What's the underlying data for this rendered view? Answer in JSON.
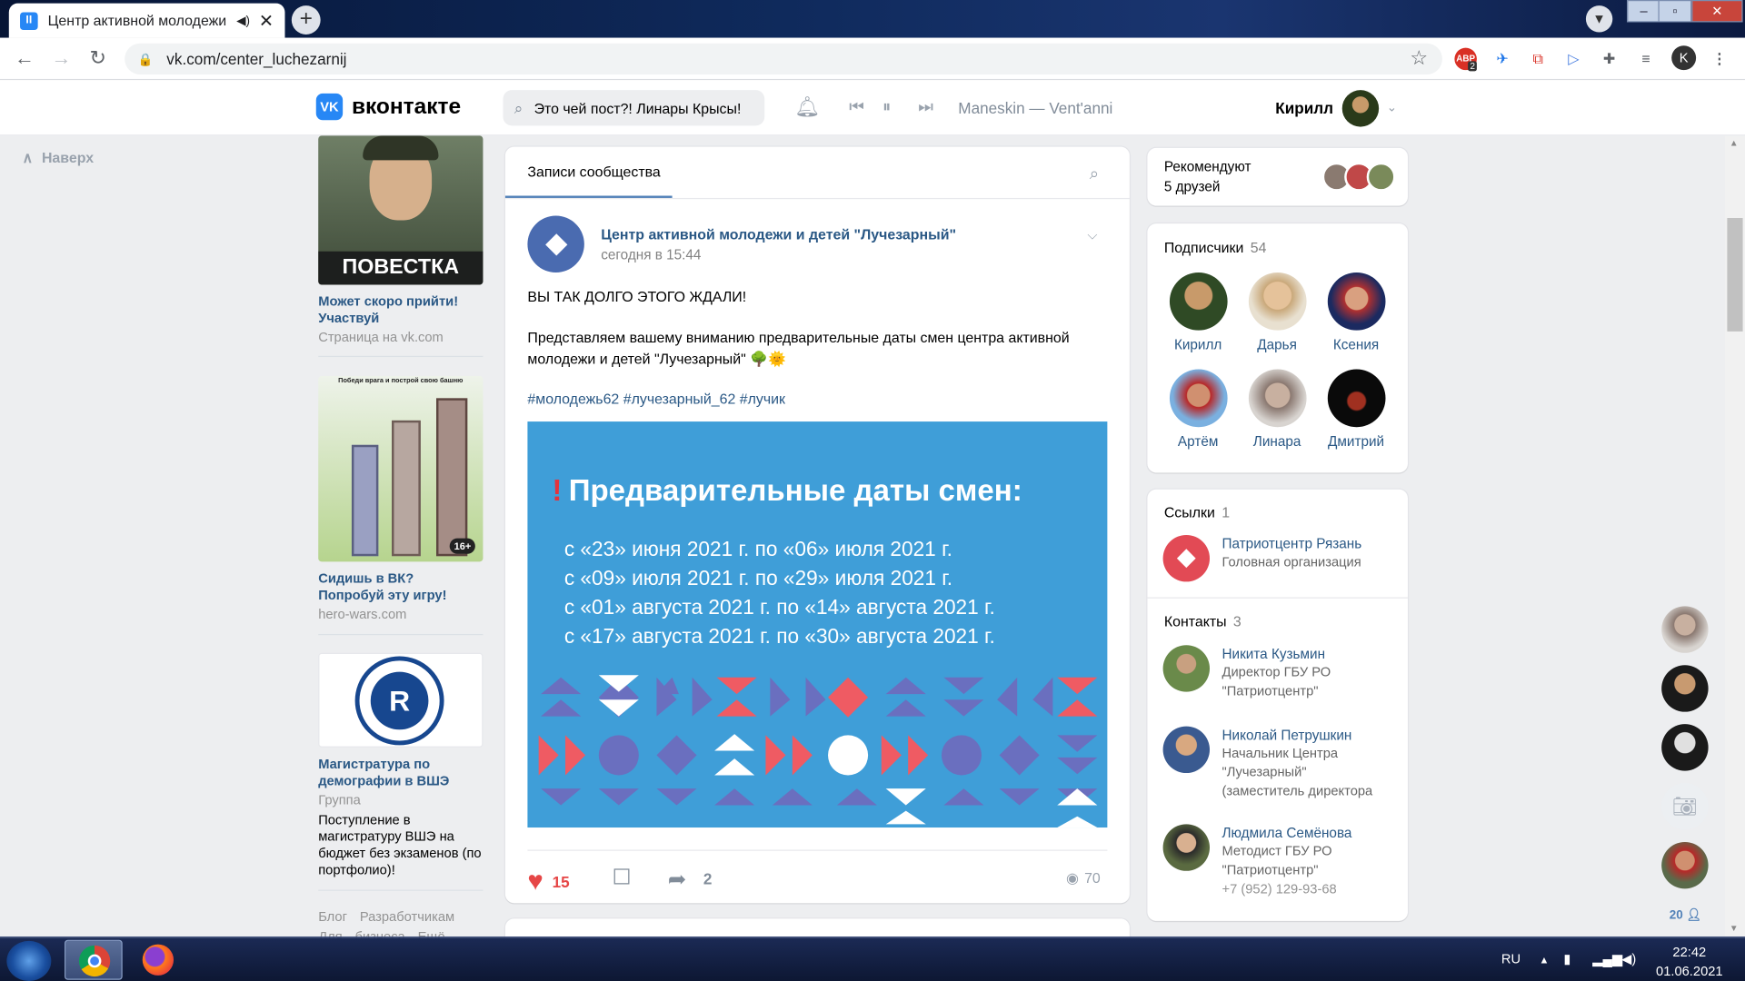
{
  "browser": {
    "tab_title": "Центр активной молодежи",
    "tab_close": "✕",
    "new_tab": "+",
    "url": "vk.com/center_luchezarnij",
    "profile_letter": "K",
    "abp_count": "2"
  },
  "header": {
    "logo_text": "вконтакте",
    "search_value": "Это чей пост?! Линары Крысы!",
    "now_playing": "Maneskin — Vent'anni",
    "user_name": "Кирилл"
  },
  "left": {
    "back_to_top": "Наверх",
    "ads": [
      {
        "banner": "ПОВЕСТКА",
        "title": "Может скоро прийти! Участвуй",
        "sub": "Страница на vk.com"
      },
      {
        "banner_top": "Победи врага и построй свою башню",
        "badge": "16+",
        "title": "Сидишь в ВК? Попробуй эту игру!",
        "sub": "hero-wars.com"
      },
      {
        "title": "Магистратура по демографии в ВШЭ",
        "sub": "Группа",
        "desc": "Поступление в магистратуру ВШЭ на бюджет без экзаменов (по портфолио)!"
      }
    ],
    "footer": "Блог Разработчикам",
    "footer2": "Для бизнеса Ещё"
  },
  "post": {
    "tab_label": "Записи сообщества",
    "group_name": "Центр активной молодежи и детей \"Лучезарный\"",
    "date": "сегодня в 15:44",
    "line1": "ВЫ ТАК ДОЛГО ЭТОГО ЖДАЛИ!",
    "line2": "Представляем вашему вниманию предварительные даты смен центра активной молодежи и детей \"Лучезарный\" 🌳🌞",
    "tags": "#молодежь62 #лучезарный_62 #лучик",
    "image": {
      "title": "Предварительные даты смен:",
      "dates": [
        "с «23» июня 2021 г. по «06» июля 2021 г.",
        "с «09» июля 2021 г. по «29» июля 2021 г.",
        "с «01» августа 2021 г. по «14» августа 2021 г.",
        "с «17» августа 2021 г. по «30» августа 2021 г."
      ]
    },
    "likes": "15",
    "shares": "2",
    "views": "70"
  },
  "right": {
    "recommend_title": "Рекомендуют",
    "recommend_sub": "5 друзей",
    "subscribers_title": "Подписчики",
    "subscribers_count": "54",
    "subscribers": [
      "Кирилл",
      "Дарья",
      "Ксения",
      "Артём",
      "Линара",
      "Дмитрий"
    ],
    "links_title": "Ссылки",
    "links_count": "1",
    "link": {
      "name": "Патриотцентр Рязань",
      "desc": "Головная организация"
    },
    "contacts_title": "Контакты",
    "contacts_count": "3",
    "contacts": [
      {
        "name": "Никита Кузьмин",
        "desc": "Директор ГБУ РО \"Патриотцентр\""
      },
      {
        "name": "Николай Петрушкин",
        "desc": "Начальник Центра \"Лучезарный\" (заместитель директора"
      },
      {
        "name": "Людмила Семёнова",
        "desc": "Методист ГБУ РО \"Патриотцентр\"",
        "phone": "+7 (952) 129-93-68"
      }
    ],
    "online_count": "20"
  },
  "taskbar": {
    "lang": "RU",
    "time": "22:42",
    "date": "01.06.2021"
  }
}
